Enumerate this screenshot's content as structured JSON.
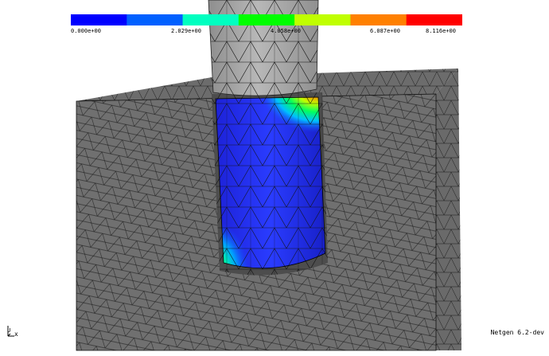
{
  "colorbar": {
    "labels": [
      "0.000e+00",
      "2.029e+00",
      "4.058e+00",
      "6.087e+00",
      "8.116e+00"
    ],
    "colors": [
      "#0000ff",
      "#0060ff",
      "#00ffc0",
      "#00ff00",
      "#c0ff00",
      "#ff8000",
      "#ff0000"
    ]
  },
  "axis": {
    "label": "x",
    "y_label": "U"
  },
  "status": {
    "version": "Netgen 6.2-dev"
  },
  "scene": {
    "mesh_color": "#6e6e6e",
    "rod_color": "#a8a8a8",
    "min_color": "#1a28f0",
    "max_color": "#ff1010"
  }
}
